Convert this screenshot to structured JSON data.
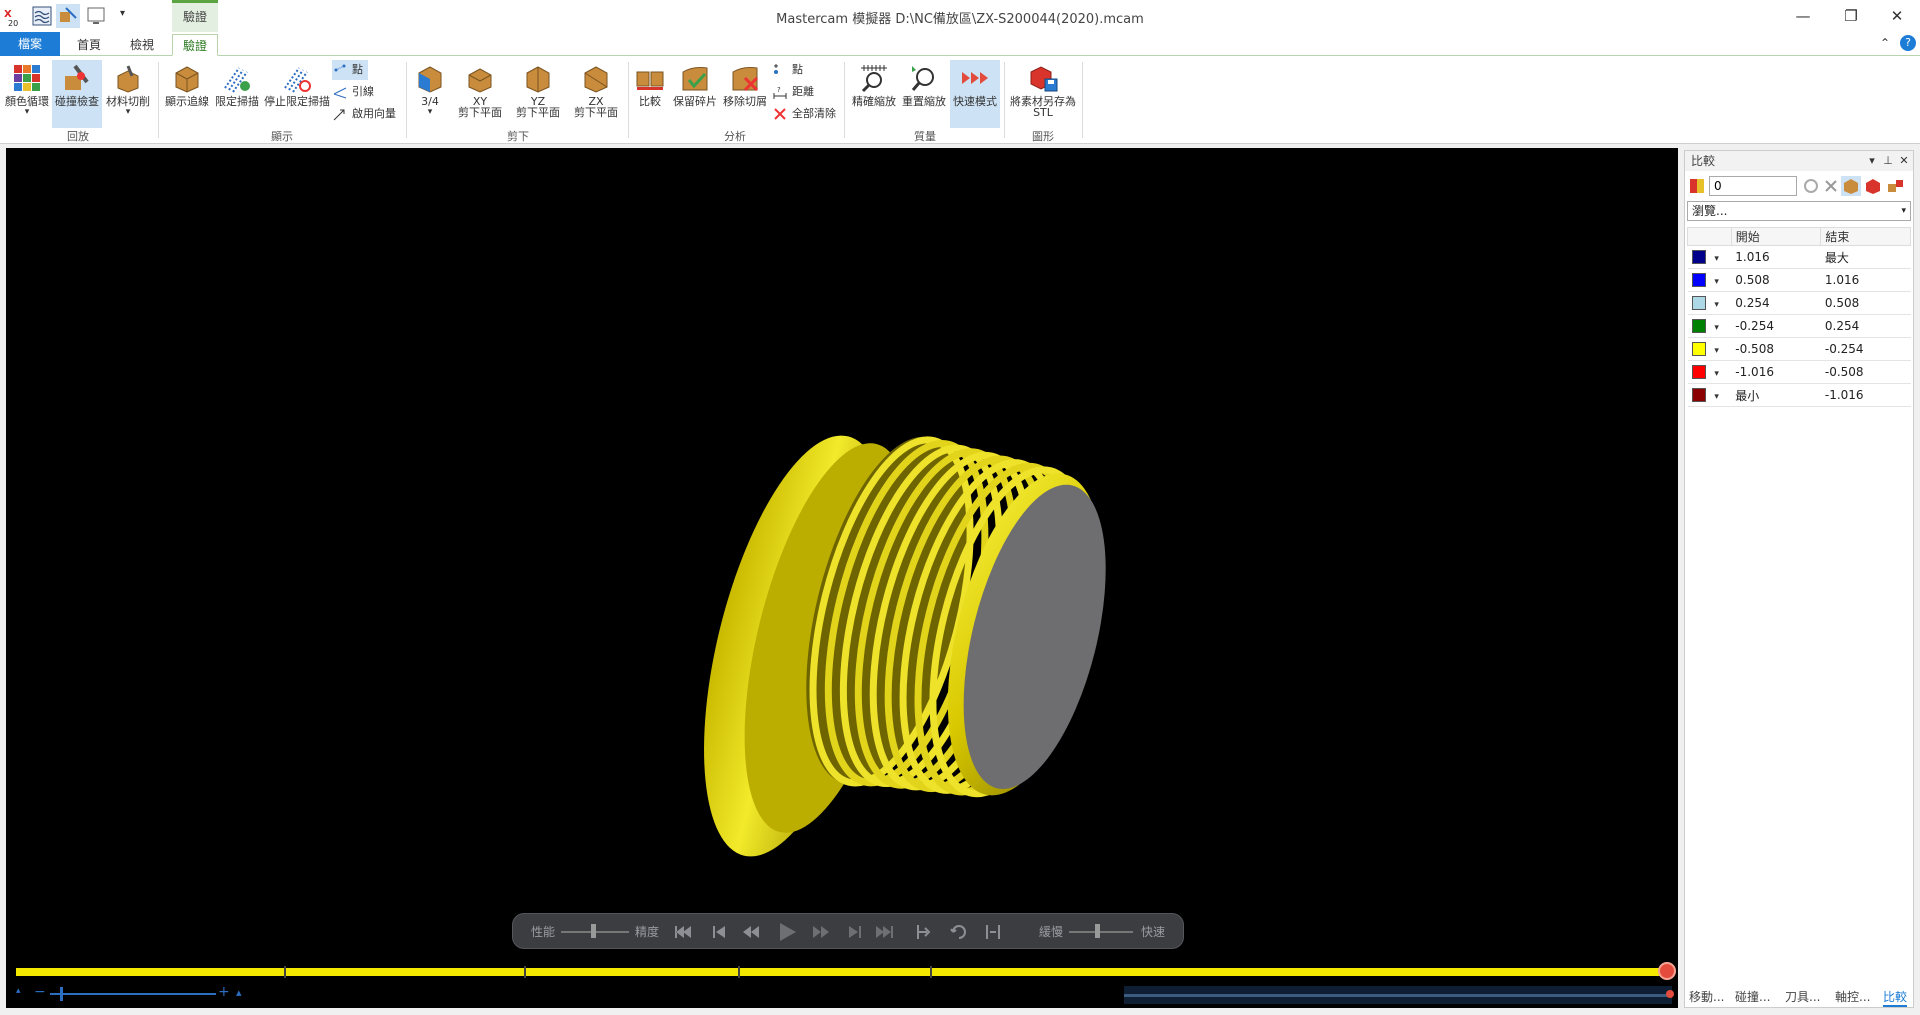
{
  "window": {
    "title": "Mastercam 模擬器  D:\\NC備放區\\ZX-S200044(2020).mcam",
    "context_tab": "驗證",
    "minimize": "—",
    "restore": "❐",
    "close": "✕"
  },
  "tabs": {
    "file": "檔案",
    "home": "首頁",
    "view": "檢視",
    "verify": "驗證"
  },
  "ribbon": {
    "color_cycle": "顏色循環",
    "collision_check": "碰撞檢查",
    "material_cut": "材料切削",
    "show_trace": "顯示追線",
    "limit_scan": "限定掃描",
    "stop_limit_scan": "停止限定掃描",
    "point": "點",
    "leader": "引線",
    "enable_direction": "啟用向量",
    "three_quarter": "3/4",
    "xy_cut": "XY",
    "xy_cut_2": "剪下平面",
    "yz_cut": "YZ",
    "yz_cut_2": "剪下平面",
    "zx_cut": "ZX",
    "zx_cut_2": "剪下平面",
    "compare": "比較",
    "keep_chips": "保留碎片",
    "remove_chips": "移除切屑",
    "point2": "點",
    "distance": "距離",
    "clear_all": "全部清除",
    "precise_zoom": "精確縮放",
    "reset_zoom": "重置縮放",
    "fast_mode": "快速模式",
    "save_stl": "將素材另存為",
    "save_stl_2": "STL",
    "groups": {
      "playback": "回放",
      "display": "顯示",
      "cut": "剪下",
      "analysis": "分析",
      "quality": "質量",
      "graphics": "圖形"
    }
  },
  "controls": {
    "performance": "性能",
    "precision": "精度",
    "slow": "緩慢",
    "fast": "快速"
  },
  "panel": {
    "title": "比較",
    "input_value": "0",
    "browse": "瀏覽...",
    "col_start": "開始",
    "col_end": "結束",
    "rows": [
      {
        "color": "#00008b",
        "start": "1.016",
        "end": "最大"
      },
      {
        "color": "#0000ff",
        "start": "0.508",
        "end": "1.016"
      },
      {
        "color": "#add8e6",
        "start": "0.254",
        "end": "0.508"
      },
      {
        "color": "#008000",
        "start": "-0.254",
        "end": "0.254"
      },
      {
        "color": "#ffff00",
        "start": "-0.508",
        "end": "-0.254"
      },
      {
        "color": "#ff0000",
        "start": "-1.016",
        "end": "-0.508"
      },
      {
        "color": "#8b0000",
        "start": "最小",
        "end": "-1.016"
      }
    ],
    "tabs": {
      "move": "移動...",
      "collision": "碰撞...",
      "tool": "刀具...",
      "axis": "軸控...",
      "compare": "比較"
    }
  }
}
